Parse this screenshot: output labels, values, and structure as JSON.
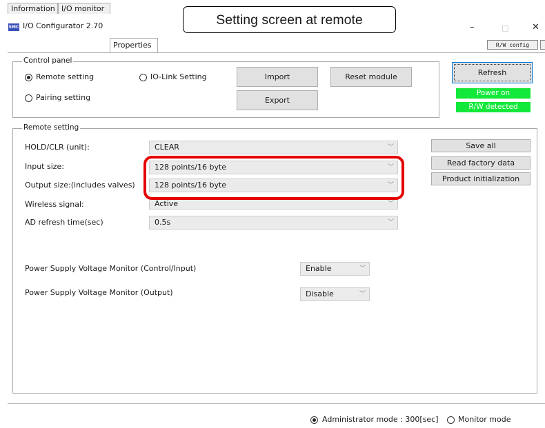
{
  "annotation": {
    "text": "Setting screen at remote"
  },
  "window": {
    "title": "I/O Configurator 2.70",
    "icon_text": "SMC",
    "minimize": "–",
    "maximize": "□",
    "close": "✕"
  },
  "tabs": [
    {
      "label": "Information"
    },
    {
      "label": "I/O monitor"
    },
    {
      "label": "Properties"
    }
  ],
  "rw_config": "R/W config",
  "control_panel": {
    "legend": "Control panel",
    "remote_setting": "Remote setting",
    "iolink_setting": "IO-Link Setting",
    "pairing_setting": "Pairing setting",
    "import": "Import",
    "export": "Export",
    "reset_module": "Reset module",
    "refresh": "Refresh",
    "power_on": "Power on",
    "rw_detected": "R/W detected"
  },
  "remote_setting": {
    "legend": "Remote setting",
    "fields": [
      {
        "label": "HOLD/CLR (unit):",
        "value": "CLEAR"
      },
      {
        "label": "Input size:",
        "value": "128 points/16 byte"
      },
      {
        "label": "Output size:(includes valves)",
        "value": "128 points/16 byte"
      },
      {
        "label": "Wireless signal:",
        "value": "Active"
      },
      {
        "label": "AD refresh time(sec)",
        "value": "0.5s"
      }
    ],
    "monitors": [
      {
        "label": "Power Supply Voltage Monitor (Control/Input)",
        "value": "Enable"
      },
      {
        "label": "Power Supply Voltage Monitor (Output)",
        "value": "Disable"
      }
    ],
    "save_all": "Save all",
    "read_factory": "Read factory data",
    "product_init": "Product initialization"
  },
  "footer": {
    "admin_mode": "Administrator mode : 300[sec]",
    "monitor_mode": "Monitor mode"
  },
  "colors": {
    "status_green": "#12e83a",
    "highlight_red": "#e50000",
    "focus_blue": "#0078d7"
  }
}
